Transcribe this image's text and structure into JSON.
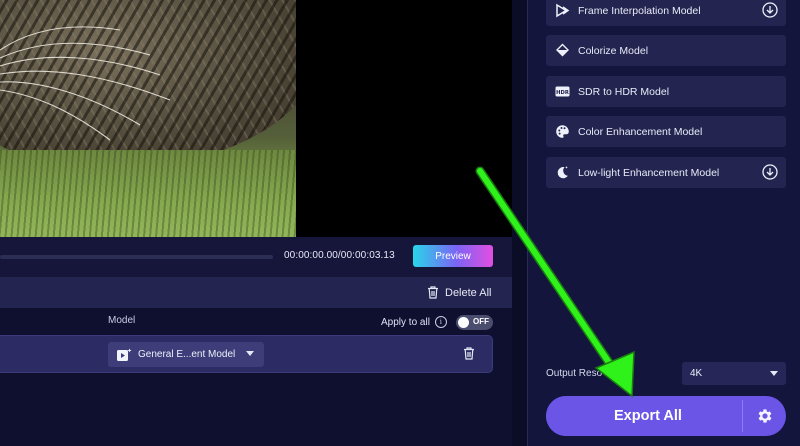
{
  "timeline": {
    "time_display": "00:00:00.00/00:00:03.13",
    "preview_label": "Preview",
    "progress": 0.0
  },
  "list": {
    "delete_all_label": "Delete All",
    "model_header": "Model",
    "apply_to_all_label": "Apply to all",
    "toggle_state": "OFF",
    "row": {
      "model_value": "General E...ent Model"
    }
  },
  "right_panel": {
    "models": [
      {
        "label": "Frame Interpolation Model",
        "icon": "frame-interpolation-icon",
        "downloadable": true
      },
      {
        "label": "Colorize Model",
        "icon": "colorize-icon",
        "downloadable": false
      },
      {
        "label": "SDR to HDR Model",
        "icon": "hdr-icon",
        "downloadable": false
      },
      {
        "label": "Color Enhancement Model",
        "icon": "palette-icon",
        "downloadable": false
      },
      {
        "label": "Low-light Enhancement Model",
        "icon": "moon-icon",
        "downloadable": true
      }
    ],
    "output_resolution_label": "Output Reso",
    "resolution_value": "4K",
    "export_label": "Export All"
  },
  "colors": {
    "accent": "#6a55e6",
    "preview_gradient": [
      "#27d6e8",
      "#7d63f4",
      "#e24fe0"
    ],
    "annotation_arrow": "#2ff21b"
  }
}
